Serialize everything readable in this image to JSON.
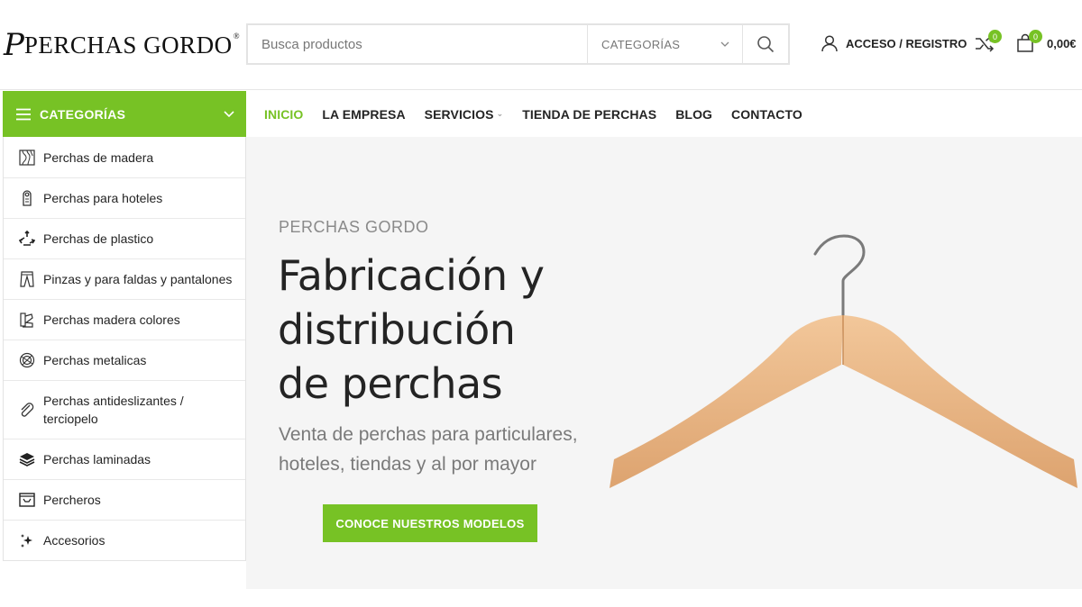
{
  "header": {
    "logo_mark": "P",
    "logo_text": "PERCHAS GORDO",
    "logo_reg": "®",
    "search_placeholder": "Busca productos",
    "category_select": "CATEGORÍAS",
    "account_label": "ACCESO / REGISTRO",
    "compare_count": "0",
    "cart_count": "0",
    "cart_total": "0,00€"
  },
  "categories": {
    "title": "CATEGORÍAS",
    "items": [
      {
        "label": "Perchas de madera",
        "icon": "wood-texture-icon"
      },
      {
        "label": "Perchas para hoteles",
        "icon": "door-hanger-icon"
      },
      {
        "label": "Perchas de plastico",
        "icon": "recycle-icon"
      },
      {
        "label": "Pinzas y para faldas y pantalones",
        "icon": "trousers-icon"
      },
      {
        "label": "Perchas madera colores",
        "icon": "color-palette-icon"
      },
      {
        "label": "Perchas metalicas",
        "icon": "metal-ring-icon"
      },
      {
        "label": "Perchas antideslizantes / terciopelo",
        "icon": "paperclip-icon"
      },
      {
        "label": "Perchas laminadas",
        "icon": "layers-icon"
      },
      {
        "label": "Percheros",
        "icon": "clothes-rack-icon"
      },
      {
        "label": "Accesorios",
        "icon": "sparkles-icon"
      }
    ]
  },
  "nav": {
    "items": [
      {
        "label": "INICIO",
        "active": true
      },
      {
        "label": "LA EMPRESA"
      },
      {
        "label": "SERVICIOS",
        "dropdown": true
      },
      {
        "label": "TIENDA DE PERCHAS"
      },
      {
        "label": "BLOG"
      },
      {
        "label": "CONTACTO"
      }
    ]
  },
  "hero": {
    "subtitle": "PERCHAS GORDO",
    "title_line1": "Fabricación y",
    "title_line2": "distribución",
    "title_line3": "de perchas",
    "description": "Venta de perchas para particulares, hoteles, tiendas y al por mayor",
    "cta": "CONOCE NUESTROS MODELOS"
  },
  "colors": {
    "accent": "#77c225",
    "hero_bg": "#f5f5f5",
    "wood": "#e8b889"
  }
}
